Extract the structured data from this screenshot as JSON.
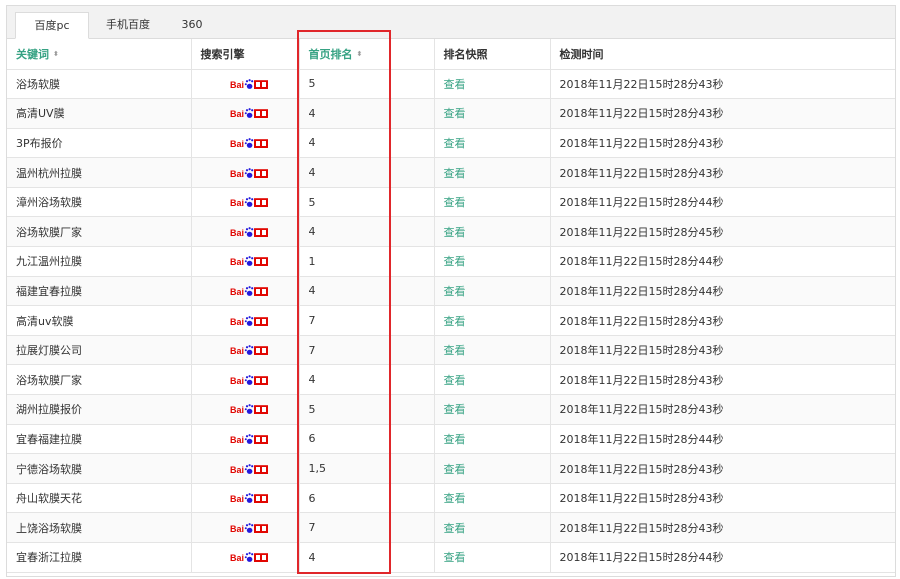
{
  "tabs": [
    {
      "label": "百度pc",
      "active": true
    },
    {
      "label": "手机百度",
      "active": false
    },
    {
      "label": "360",
      "active": false
    }
  ],
  "columns": {
    "keyword": "关键词",
    "engine": "搜索引擎",
    "rank": "首页排名",
    "snapshot": "排名快照",
    "time": "检测时间"
  },
  "sort_icon": "⬍",
  "snapshot_label": "查看",
  "engine_icon": "baidu-logo-icon",
  "colors": {
    "accent": "#36a283",
    "highlight": "#e0262a",
    "baidu_red": "#e10601",
    "baidu_blue": "#2319dc"
  },
  "rows": [
    {
      "keyword": "浴场软膜",
      "rank": "5",
      "time": "2018年11月22日15时28分43秒"
    },
    {
      "keyword": "高清UV膜",
      "rank": "4",
      "time": "2018年11月22日15时28分43秒"
    },
    {
      "keyword": "3P布报价",
      "rank": "4",
      "time": "2018年11月22日15时28分43秒"
    },
    {
      "keyword": "温州杭州拉膜",
      "rank": "4",
      "time": "2018年11月22日15时28分43秒"
    },
    {
      "keyword": "漳州浴场软膜",
      "rank": "5",
      "time": "2018年11月22日15时28分44秒"
    },
    {
      "keyword": "浴场软膜厂家",
      "rank": "4",
      "time": "2018年11月22日15时28分45秒"
    },
    {
      "keyword": "九江温州拉膜",
      "rank": "1",
      "time": "2018年11月22日15时28分44秒"
    },
    {
      "keyword": "福建宜春拉膜",
      "rank": "4",
      "time": "2018年11月22日15时28分44秒"
    },
    {
      "keyword": "高清uv软膜",
      "rank": "7",
      "time": "2018年11月22日15时28分43秒"
    },
    {
      "keyword": "拉展灯膜公司",
      "rank": "7",
      "time": "2018年11月22日15时28分43秒"
    },
    {
      "keyword": "浴场软膜厂家",
      "rank": "4",
      "time": "2018年11月22日15时28分43秒"
    },
    {
      "keyword": "湖州拉膜报价",
      "rank": "5",
      "time": "2018年11月22日15时28分43秒"
    },
    {
      "keyword": "宜春福建拉膜",
      "rank": "6",
      "time": "2018年11月22日15时28分44秒"
    },
    {
      "keyword": "宁德浴场软膜",
      "rank": "1,5",
      "time": "2018年11月22日15时28分43秒"
    },
    {
      "keyword": "舟山软膜天花",
      "rank": "6",
      "time": "2018年11月22日15时28分43秒"
    },
    {
      "keyword": "上饶浴场软膜",
      "rank": "7",
      "time": "2018年11月22日15时28分43秒"
    },
    {
      "keyword": "宜春浙江拉膜",
      "rank": "4",
      "time": "2018年11月22日15时28分44秒"
    }
  ]
}
